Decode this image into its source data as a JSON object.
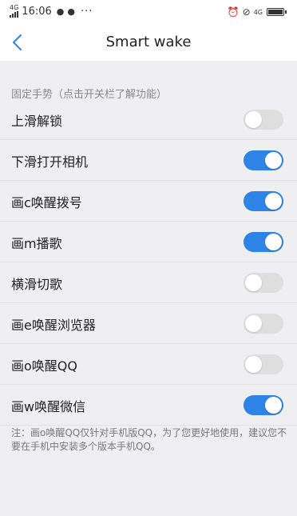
{
  "status_bar": {
    "signal": "4G",
    "time": "16:06",
    "more": "···",
    "network": "4G",
    "icons": [
      "chat-icon",
      "location-icon",
      "alarm-icon",
      "silent-icon",
      "battery-icon"
    ]
  },
  "header": {
    "title": "Smart wake",
    "back_icon": "chevron-left-icon",
    "accent": "#2e84e6"
  },
  "section": {
    "title": "固定手势（点击开关栏了解功能）"
  },
  "gestures": [
    {
      "label": "上滑解锁",
      "enabled": false
    },
    {
      "label": "下滑打开相机",
      "enabled": true
    },
    {
      "label": "画c唤醒拨号",
      "enabled": true
    },
    {
      "label": "画m播歌",
      "enabled": true
    },
    {
      "label": "横滑切歌",
      "enabled": false
    },
    {
      "label": "画e唤醒浏览器",
      "enabled": false
    },
    {
      "label": "画o唤醒QQ",
      "enabled": false
    },
    {
      "label": "画w唤醒微信",
      "enabled": true
    }
  ],
  "note": "注：画o唤醒QQ仅针对手机版QQ，为了您更好地使用，建议您不要在手机中安装多个版本手机QQ。"
}
